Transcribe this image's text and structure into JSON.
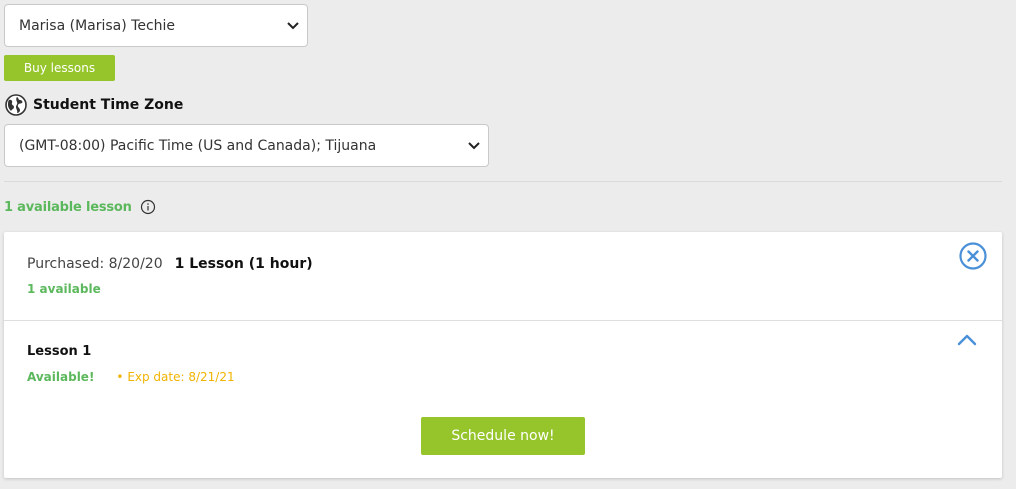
{
  "student_select": {
    "value": "Marisa (Marisa) Techie"
  },
  "buy_button": {
    "label": "Buy lessons"
  },
  "timezone": {
    "label": "Student Time Zone",
    "value": "(GMT-08:00) Pacific Time (US and Canada); Tijuana"
  },
  "availability": {
    "summary": "1 available lesson"
  },
  "package": {
    "purchased": "Purchased: 8/20/20",
    "title": "1 Lesson (1 hour)",
    "available": "1 available"
  },
  "lesson": {
    "title": "Lesson 1",
    "status": "Available!",
    "expiry": "• Exp date: 8/21/21",
    "schedule_label": "Schedule now!"
  },
  "colors": {
    "accent_green": "#95c52a",
    "status_green": "#5cb85c",
    "expiry_yellow": "#f0b400",
    "icon_blue": "#4a90d9"
  },
  "icons": [
    "chevron-down-icon",
    "globe-icon",
    "info-icon",
    "close-circle-icon",
    "chevron-up-icon"
  ]
}
